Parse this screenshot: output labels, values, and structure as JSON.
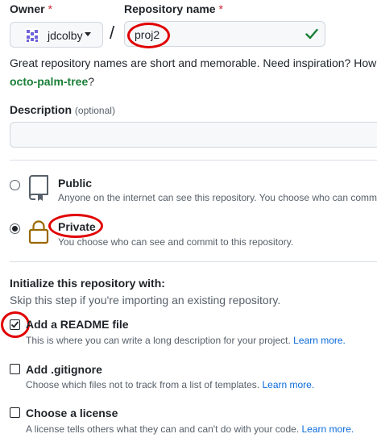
{
  "owner": {
    "label": "Owner",
    "required_mark": "*",
    "value": "jdcolby"
  },
  "separator": "/",
  "repo": {
    "label": "Repository name",
    "required_mark": "*",
    "value": "proj2"
  },
  "hint": "Great repository names are short and memorable. Need inspiration? How a",
  "suggestion": {
    "name": "octo-palm-tree",
    "suffix": "?"
  },
  "description": {
    "label": "Description",
    "optional": "(optional)",
    "value": ""
  },
  "visibility": {
    "options": [
      {
        "title": "Public",
        "desc": "Anyone on the internet can see this repository. You choose who can comm",
        "checked": false,
        "icon": "repo-icon"
      },
      {
        "title": "Private",
        "desc": "You choose who can see and commit to this repository.",
        "checked": true,
        "icon": "lock-icon"
      }
    ]
  },
  "init": {
    "label": "Initialize this repository with:",
    "skip": "Skip this step if you're importing an existing repository.",
    "options": [
      {
        "title": "Add a README file",
        "desc": "This is where you can write a long description for your project.",
        "link": "Learn more.",
        "checked": true
      },
      {
        "title": "Add .gitignore",
        "desc": "Choose which files not to track from a list of templates.",
        "link": "Learn more.",
        "checked": false
      },
      {
        "title": "Choose a license",
        "desc": "A license tells others what they can and can't do with your code.",
        "link": "Learn more.",
        "checked": false
      }
    ]
  },
  "colors": {
    "accent_link": "#0969da",
    "success": "#1a7f37",
    "required": "#cf222e",
    "annotation": "#e00000"
  }
}
